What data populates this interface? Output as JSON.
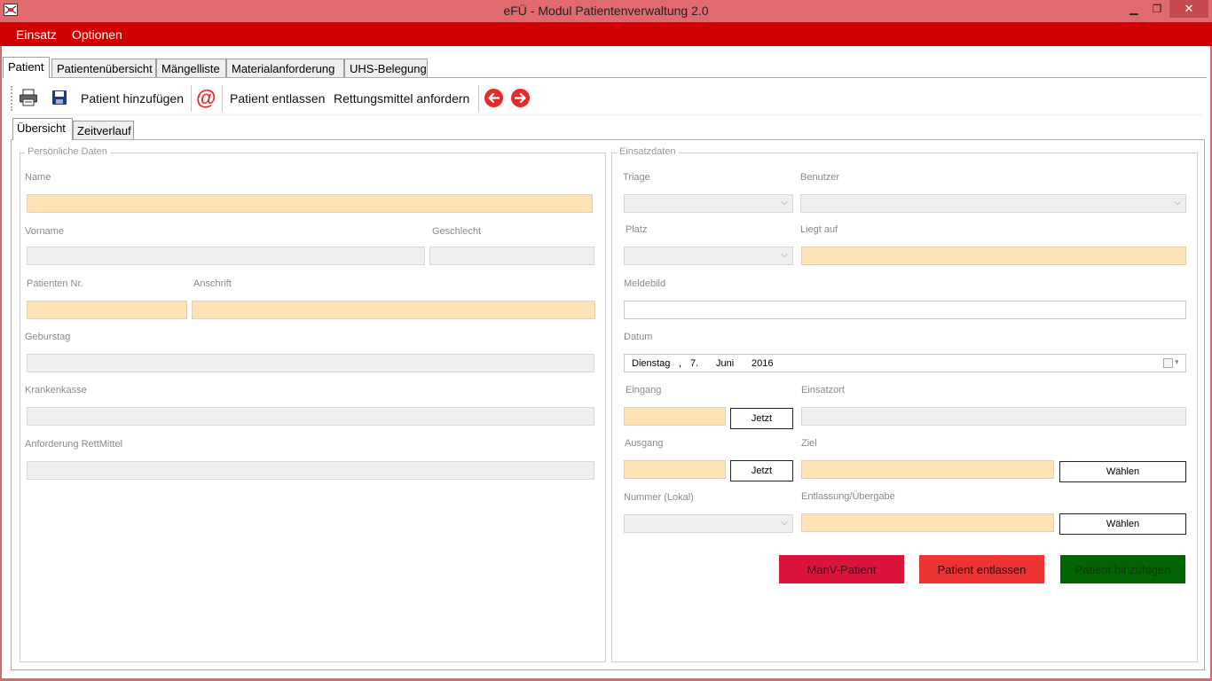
{
  "window": {
    "title": "eFÜ - Modul Patientenverwaltung 2.0",
    "minimize": "▁",
    "maximize": "❐",
    "close": "✕"
  },
  "menu": {
    "items": [
      "Einsatz",
      "Optionen"
    ]
  },
  "tabs": [
    "Patient",
    "Patientenübersicht",
    "Mängelliste",
    "Materialanforderung",
    "UHS-Belegung"
  ],
  "toolbar": {
    "add_patient": "Patient hinzufügen",
    "at_symbol": "@",
    "discharge": "Patient entlassen",
    "request_rescue": "Rettungsmittel anfordern",
    "back_arrow": "🡐",
    "forward_arrow": "🡒"
  },
  "subtabs": [
    "Übersicht",
    "Zeitverlauf"
  ],
  "personal": {
    "legend": "Persönliche Daten",
    "name_label": "Name",
    "vorname_label": "Vorname",
    "geschlecht_label": "Geschlecht",
    "patnr_label": "Patienten Nr.",
    "anschrift_label": "Anschrift",
    "geburtstag_label": "Geburstag",
    "krankenkasse_label": "Krankenkasse",
    "anforderung_label": "Anforderung RettMittel"
  },
  "einsatz": {
    "legend": "Einsatzdaten",
    "triage_label": "Triage",
    "benutzer_label": "Benutzer",
    "platz_label": "Platz",
    "liegt_auf_label": "Liegt auf",
    "meldebild_label": "Meldebild",
    "datum_label": "Datum",
    "datum": {
      "weekday": "Dienstag",
      "comma": ",",
      "day": "7.",
      "month": "Juni",
      "year": "2016"
    },
    "eingang_label": "Eingang",
    "einsatzort_label": "Einsatzort",
    "ausgang_label": "Ausgang",
    "ziel_label": "Ziel",
    "nummer_label": "Nummer (Lokal)",
    "entlassung_label": "Entlassung/Übergabe",
    "jetzt": "Jetzt",
    "waehlen": "Wählen"
  },
  "actions": {
    "manv": "ManV-Patient",
    "entlassen": "Patient entlassen",
    "hinzufuegen": "Patient hinzufügen"
  },
  "colors": {
    "titlebar": "#e06a6e",
    "menubar": "#d10000",
    "peach_field": "#fde3b7",
    "manv_button": "#dc143c",
    "discharge_button": "#ee3333",
    "add_button": "#006400"
  },
  "icons": [
    "app-icon",
    "printer-icon",
    "save-icon",
    "at-icon",
    "arrow-left-icon",
    "arrow-right-icon",
    "chevron-down-icon",
    "calendar-icon"
  ]
}
